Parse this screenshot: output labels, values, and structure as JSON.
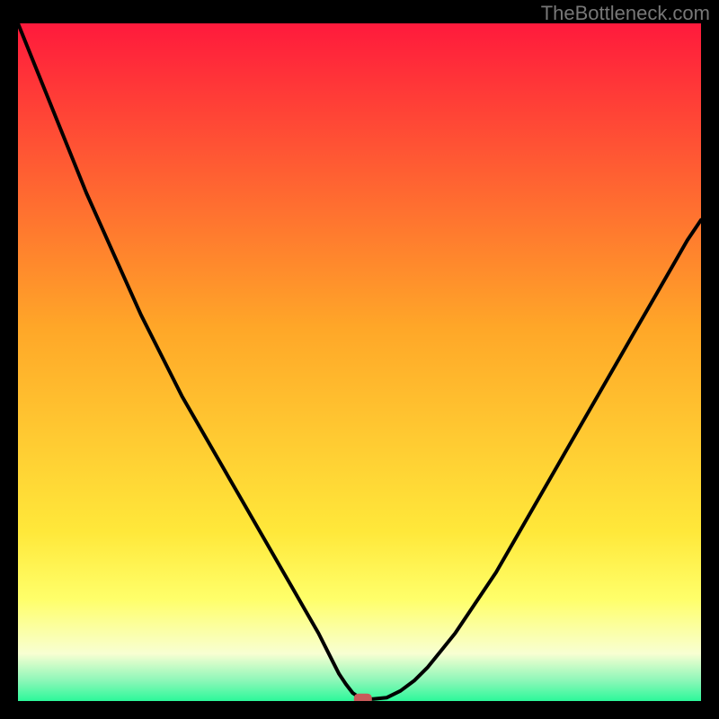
{
  "watermark": "TheBottleneck.com",
  "colors": {
    "top": "#ff1a3c",
    "mid": "#ffa728",
    "low_yellow": "#ffff6a",
    "pale": "#f8ffd2",
    "green": "#2cf89a",
    "curve": "#000000",
    "marker": "#c85a5a",
    "background": "#000000"
  },
  "chart_data": {
    "type": "line",
    "title": "",
    "xlabel": "",
    "ylabel": "",
    "xlim": [
      0,
      100
    ],
    "ylim": [
      0,
      100
    ],
    "x": [
      0,
      2,
      4,
      6,
      8,
      10,
      12,
      14,
      16,
      18,
      20,
      22,
      24,
      26,
      28,
      30,
      32,
      34,
      36,
      38,
      40,
      42,
      44,
      45,
      46,
      47,
      48,
      49,
      50,
      51,
      52,
      54,
      56,
      58,
      60,
      62,
      64,
      66,
      68,
      70,
      72,
      74,
      76,
      78,
      80,
      82,
      84,
      86,
      88,
      90,
      92,
      94,
      96,
      98,
      100
    ],
    "values": [
      100,
      95,
      90,
      85,
      80,
      75,
      70.5,
      66,
      61.5,
      57,
      53,
      49,
      45,
      41.5,
      38,
      34.5,
      31,
      27.5,
      24,
      20.5,
      17,
      13.5,
      10,
      8,
      6,
      4,
      2.5,
      1.2,
      0.5,
      0.3,
      0.3,
      0.5,
      1.5,
      3,
      5,
      7.5,
      10,
      13,
      16,
      19,
      22.5,
      26,
      29.5,
      33,
      36.5,
      40,
      43.5,
      47,
      50.5,
      54,
      57.5,
      61,
      64.5,
      68,
      71
    ],
    "marker": {
      "x": 50.5,
      "y": 0.3
    },
    "gradient_bands": [
      {
        "pos": 0.0,
        "color": "#ff1a3c"
      },
      {
        "pos": 0.45,
        "color": "#ffa728"
      },
      {
        "pos": 0.75,
        "color": "#ffe83a"
      },
      {
        "pos": 0.85,
        "color": "#ffff6a"
      },
      {
        "pos": 0.93,
        "color": "#f8ffd2"
      },
      {
        "pos": 0.97,
        "color": "#8cf7b8"
      },
      {
        "pos": 1.0,
        "color": "#2cf89a"
      }
    ]
  }
}
